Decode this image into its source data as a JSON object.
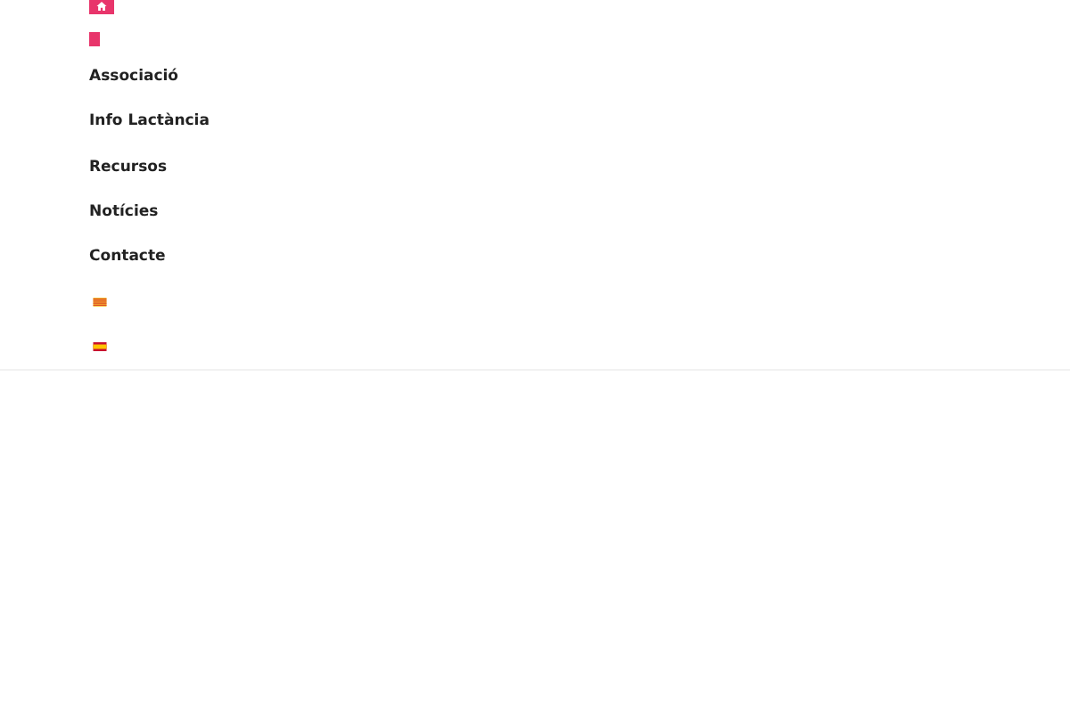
{
  "menu": [
    {
      "label": "Associació"
    },
    {
      "label": "Info Lactància"
    },
    {
      "label": "Recursos"
    },
    {
      "label": "Notícies"
    },
    {
      "label": "Contacte"
    }
  ],
  "languages": [
    {
      "kind": "catalan"
    },
    {
      "kind": "spanish"
    }
  ]
}
